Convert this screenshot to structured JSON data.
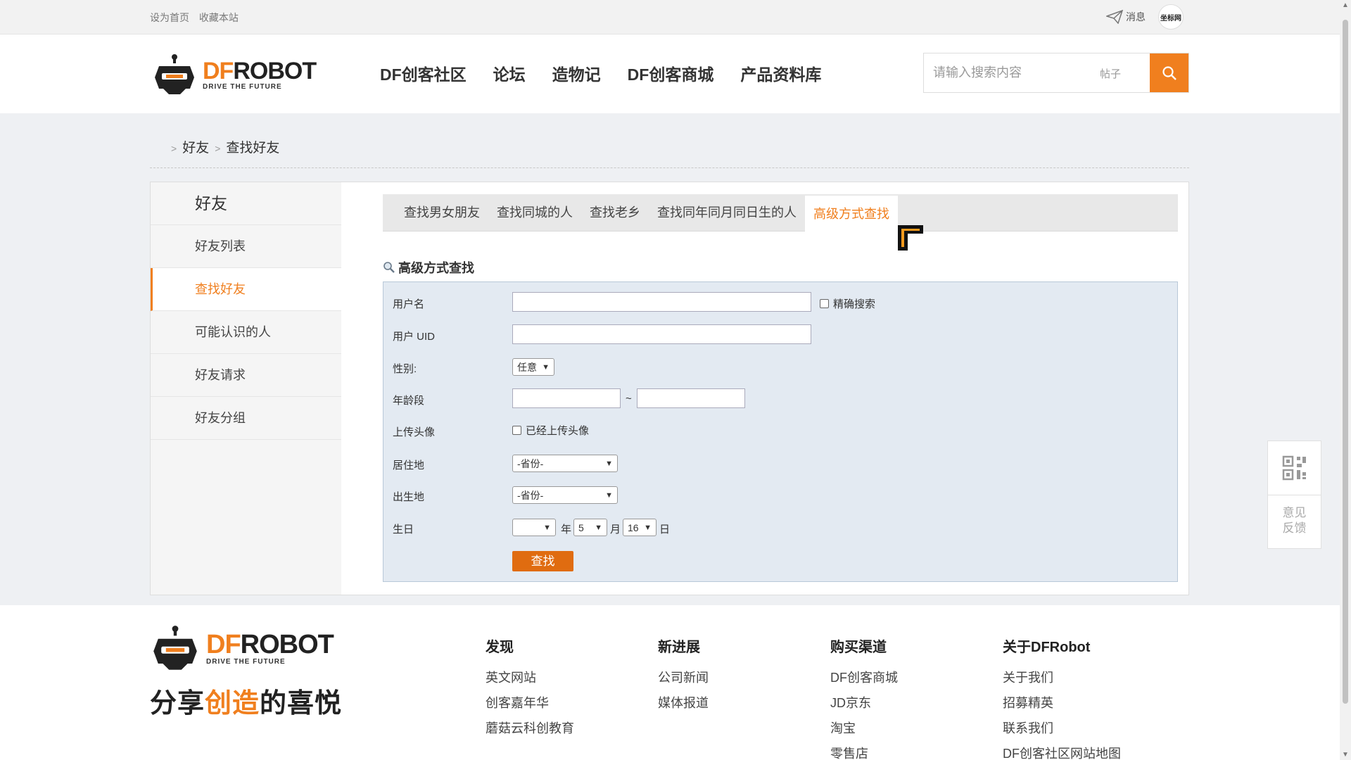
{
  "topbar": {
    "set_home": "设为首页",
    "bookmark": "收藏本站",
    "messages": "消息",
    "avatar_text": "坐标网"
  },
  "header": {
    "logo": {
      "df": "DF",
      "robot": "ROBOT",
      "tagline": "DRIVE THE FUTURE"
    },
    "nav": [
      "DF创客社区",
      "论坛",
      "造物记",
      "DF创客商城",
      "产品资料库"
    ],
    "search": {
      "placeholder": "请输入搜索内容",
      "scope": "帖子"
    }
  },
  "breadcrumb": {
    "items": [
      "好友",
      "查找好友"
    ]
  },
  "sidebar": {
    "title": "好友",
    "items": [
      "好友列表",
      "查找好友",
      "可能认识的人",
      "好友请求",
      "好友分组"
    ],
    "active_index": 1
  },
  "tabs": {
    "items": [
      "查找男女朋友",
      "查找同城的人",
      "查找老乡",
      "查找同年同月同日生的人",
      "高级方式查找"
    ],
    "active_index": 4
  },
  "form": {
    "title": "高级方式查找",
    "username_label": "用户名",
    "exact_search_label": "精确搜索",
    "uid_label": "用户 UID",
    "gender_label": "性别:",
    "gender_value": "任意",
    "age_label": "年龄段",
    "age_separator": "~",
    "avatar_label": "上传头像",
    "avatar_checkbox_label": "已经上传头像",
    "residence_label": "居住地",
    "residence_value": "-省份-",
    "birthplace_label": "出生地",
    "birthplace_value": "-省份-",
    "birthday_label": "生日",
    "birthday": {
      "year": "",
      "year_unit": "年",
      "month": "5",
      "month_unit": "月",
      "day": "16",
      "day_unit": "日"
    },
    "submit": "查找"
  },
  "footer": {
    "logo": {
      "df": "DF",
      "robot": "ROBOT",
      "tagline": "DRIVE THE FUTURE"
    },
    "slogan": {
      "pre": "分享",
      "highlight": "创造",
      "post": "的喜悦"
    },
    "columns": [
      {
        "heading": "发现",
        "links": [
          "英文网站",
          "创客嘉年华",
          "蘑菇云科创教育"
        ]
      },
      {
        "heading": "新进展",
        "links": [
          "公司新闻",
          "媒体报道"
        ]
      },
      {
        "heading": "购买渠道",
        "links": [
          "DF创客商城",
          "JD京东",
          "淘宝",
          "零售店"
        ]
      },
      {
        "heading": "关于DFRobot",
        "links": [
          "关于我们",
          "招募精英",
          "联系我们",
          "DF创客社区网站地图"
        ]
      }
    ]
  },
  "side_widget": {
    "feedback_line1": "意见",
    "feedback_line2": "反馈"
  },
  "colors": {
    "accent": "#f07f1e",
    "form_bg": "#e3eaf2",
    "page_bg": "#eef0f3"
  }
}
